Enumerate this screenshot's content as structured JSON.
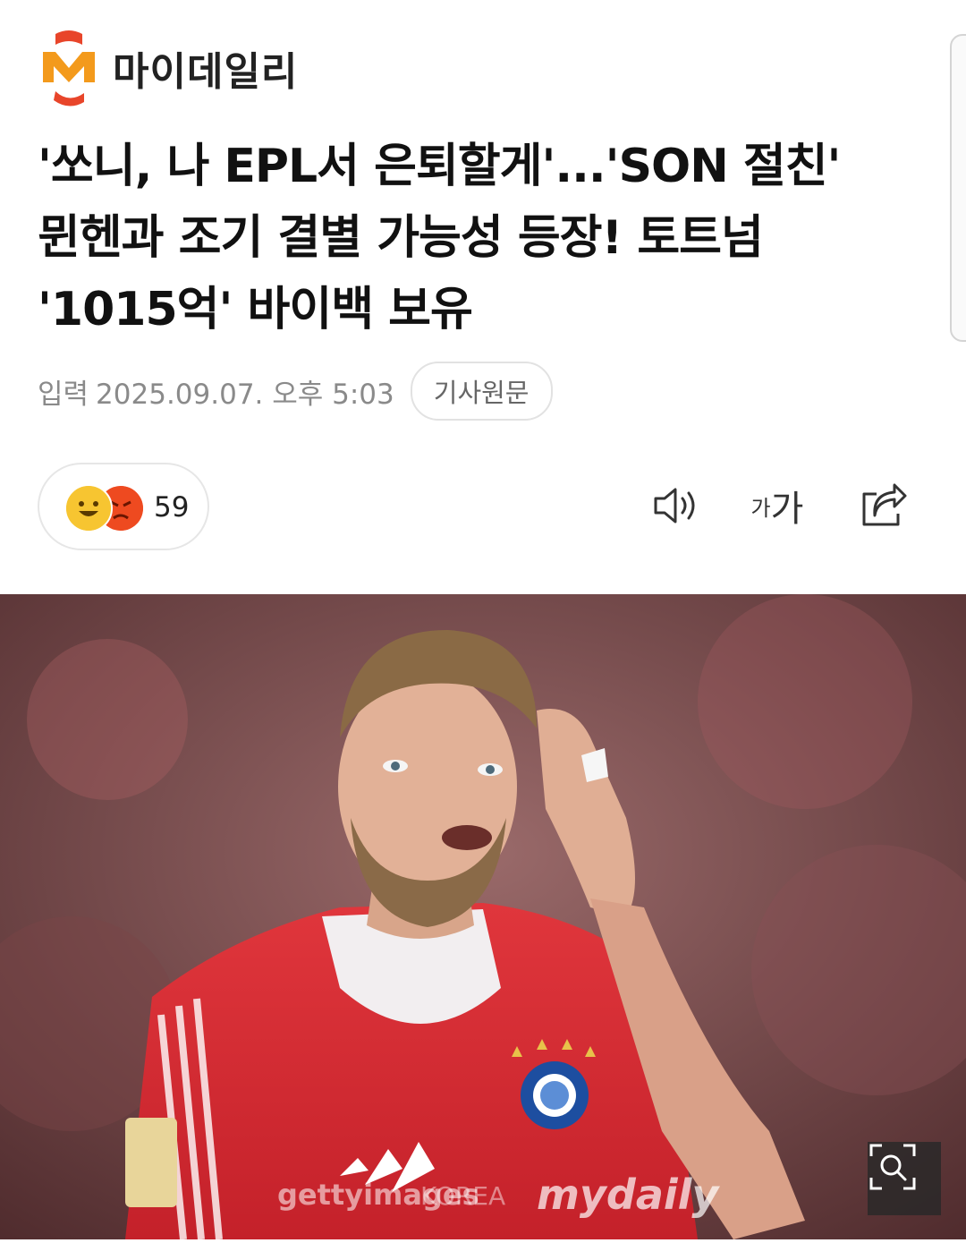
{
  "brand": {
    "name": "마이데일리",
    "logo_icon": "mydaily-logo-icon"
  },
  "article": {
    "headline_lines": [
      "'쏘니, 나 EPL서 은퇴할게'...'SON 절친'",
      "뮌헨과 조기 결별 가능성 등장! 토트넘",
      "'1015억' 바이백 보유"
    ],
    "meta_label": "입력",
    "published": "2025.09.07. 오후 5:03",
    "original_button": "기사원문"
  },
  "reactions": {
    "count": "59",
    "icons": [
      "smile-emoji-icon",
      "angry-emoji-icon"
    ]
  },
  "tools": {
    "audio_icon": "speaker-icon",
    "font_small": "가",
    "font_big": "가",
    "share_icon": "share-icon"
  },
  "photo": {
    "watermark_getty": "gettyimages",
    "watermark_korea": "KOREA",
    "watermark_brand": "mydaily",
    "zoom_icon": "zoom-icon"
  },
  "colors": {
    "brand_red": "#e8452a",
    "brand_orange": "#f39a1c",
    "meta_gray": "#8a8a8a"
  }
}
